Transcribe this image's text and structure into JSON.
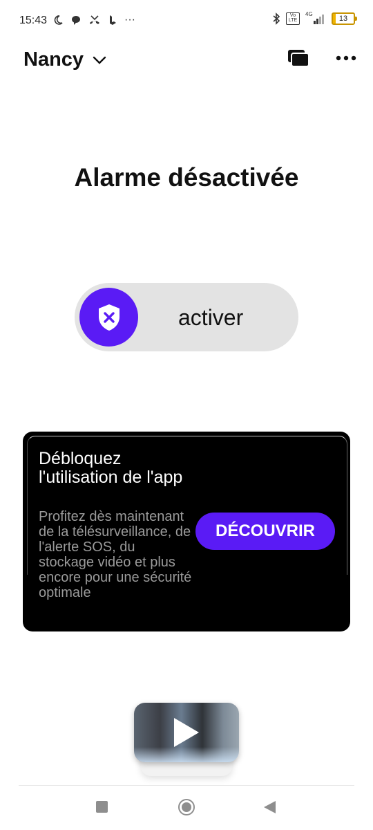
{
  "status_bar": {
    "time": "15:43",
    "left_icons": [
      "moon-icon",
      "chat-icon",
      "missed-call-icon",
      "bing-icon",
      "more-dots-icon"
    ],
    "right_icons": [
      "bluetooth-icon",
      "volte-icon",
      "signal-icon"
    ],
    "network": "4G",
    "volte": "Vo LTE",
    "battery_level": "13",
    "more": "···"
  },
  "header": {
    "home_name": "Nancy",
    "icons": [
      "chevron-down-icon",
      "cameras-icon",
      "more-icon"
    ]
  },
  "alarm": {
    "status_title": "Alarme désactivée",
    "toggle_label": "activer",
    "knob_icon": "shield-x-icon"
  },
  "promo": {
    "title": "Débloquez l'utilisation de l'app",
    "description": "Profitez dès maintenant de la télésurveillance, de l'alerte SOS, du stockage vidéo et plus encore pour une sécurité optimale",
    "button_label": "DÉCOUVRIR"
  },
  "video": {
    "icon": "play-icon"
  },
  "navbar": {
    "icons": [
      "recents-icon",
      "home-icon",
      "back-icon"
    ]
  },
  "colors": {
    "accent": "#5a1bf5",
    "toggle_bg": "#e3e3e3",
    "card_bg": "#000000"
  }
}
